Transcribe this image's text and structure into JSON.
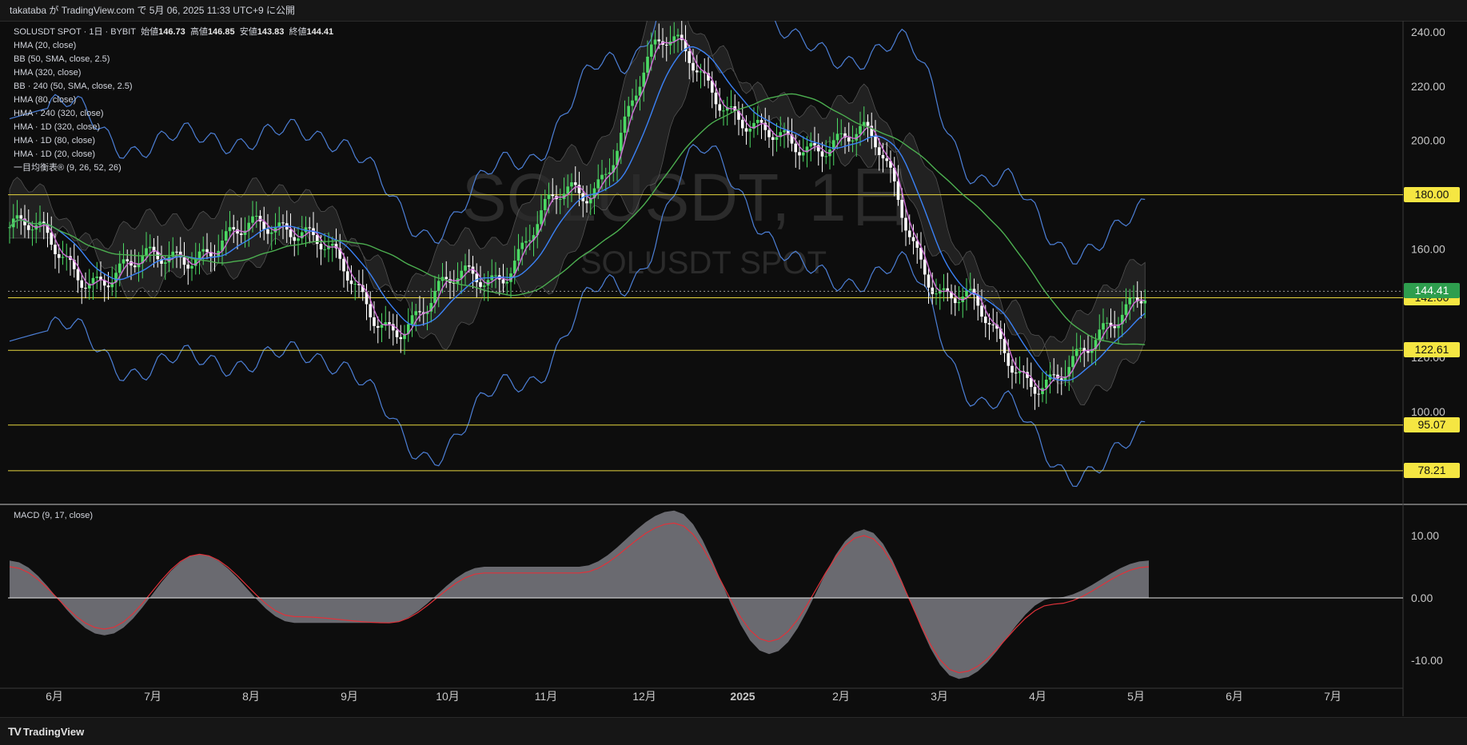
{
  "header": {
    "published": "takataba が TradingView.com で 5月 06, 2025 11:33 UTC+9 に公開"
  },
  "footer": {
    "brand": "TradingView"
  },
  "watermark": {
    "main": "SOLUSDT, 1日",
    "sub": "SOLUSDT SPOT"
  },
  "legend": {
    "symbol": "SOLUSDT SPOT · 1日 · BYBIT",
    "open_label": "始値",
    "open": "146.73",
    "high_label": "高値",
    "high": "146.85",
    "low_label": "安値",
    "low": "143.83",
    "close_label": "終値",
    "close": "144.41",
    "indicators": [
      "HMA (20, close)",
      "BB (50, SMA, close, 2.5)",
      "HMA (320, close)",
      "BB · 240 (50, SMA, close, 2.5)",
      "HMA (80, close)",
      "HMA · 240 (320, close)",
      "HMA · 1D (320, close)",
      "HMA · 1D (80, close)",
      "HMA · 1D (20, close)",
      "一目均衡表® (9, 26, 52, 26)"
    ]
  },
  "macd_legend": "MACD (9, 17, close)",
  "colors": {
    "background": "#0d0d0d",
    "up": "#4cd964",
    "down": "#ffffff",
    "hma_fast": "#d070d8",
    "hma_mid": "#3b82f6",
    "hma_slow": "#4caf50",
    "bb": "#4c7fd6",
    "level": "#e6d63f",
    "macd_fill": "#6a6a70",
    "signal": "#e0323a"
  },
  "chart_data": [
    {
      "type": "line",
      "title": "SOLUSDT SPOT · 1日 · BYBIT",
      "ylim": [
        70,
        245
      ],
      "y_ticks": [
        240,
        220,
        200,
        160,
        120,
        100
      ],
      "y_tick_labels": [
        "240.00",
        "220.00",
        "200.00",
        "160.00",
        "120.00",
        "100.00"
      ],
      "x_tick_labels": [
        "6月",
        "7月",
        "8月",
        "9月",
        "10月",
        "11月",
        "12月",
        "2025",
        "2月",
        "3月",
        "4月",
        "5月",
        "6月",
        "7月"
      ],
      "horizontal_levels": [
        180.0,
        142.0,
        122.61,
        95.07,
        78.21
      ],
      "horizontal_level_labels": [
        "180.00",
        "142.00",
        "122.61",
        "95.07",
        "78.21"
      ],
      "last_price": 144.41,
      "last_price_label": "144.41",
      "x": [
        "2024-05",
        "2024-06",
        "2024-07",
        "2024-08",
        "2024-09",
        "2024-10",
        "2024-11",
        "2024-12",
        "2025-01",
        "2025-02",
        "2025-03",
        "2025-04",
        "2025-05"
      ],
      "series": [
        {
          "values": [
            168,
            150,
            160,
            170,
            133,
            150,
            180,
            235,
            200,
            200,
            140,
            110,
            145
          ]
        }
      ]
    },
    {
      "type": "area",
      "title": "MACD (9, 17, close)",
      "ylim": [
        -14,
        15
      ],
      "y_ticks": [
        10,
        0,
        -10
      ],
      "y_tick_labels": [
        "10.00",
        "0.00",
        "-10.00"
      ],
      "x": [
        "2024-05",
        "2024-06",
        "2024-07",
        "2024-08",
        "2024-09",
        "2024-10",
        "2024-11",
        "2024-12",
        "2025-01",
        "2025-02",
        "2025-03",
        "2025-04",
        "2025-05"
      ],
      "series": [
        {
          "values": [
            6,
            -6,
            7,
            -4,
            -4,
            5,
            5,
            14,
            -9,
            11,
            -13,
            0,
            6
          ]
        },
        {
          "values": [
            5,
            -5,
            7,
            -3,
            -4,
            4,
            4,
            12,
            -7,
            10,
            -12,
            -1,
            5
          ]
        }
      ]
    }
  ]
}
